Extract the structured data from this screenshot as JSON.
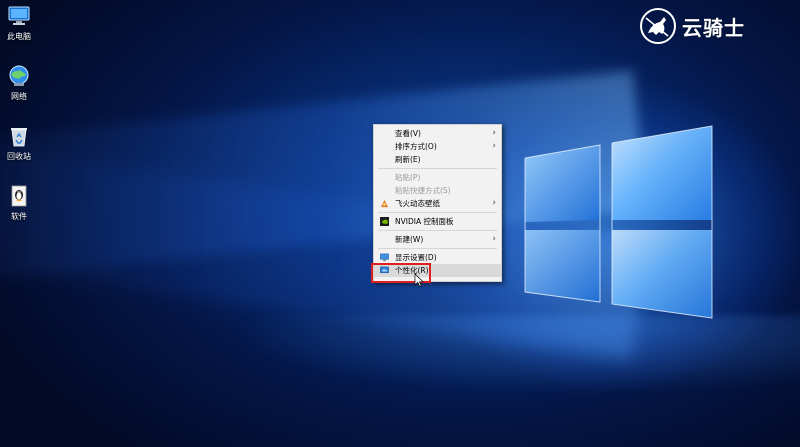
{
  "desktop": {
    "icons": [
      {
        "label": "此电脑",
        "icon": "computer-icon"
      },
      {
        "label": "网络",
        "icon": "network-globe-icon"
      },
      {
        "label": "回收站",
        "icon": "recycle-bin-icon"
      },
      {
        "label": "软件",
        "icon": "software-folder-icon"
      }
    ]
  },
  "watermark": {
    "text": "云骑士",
    "icon": "knight-rider-logo-icon"
  },
  "context_menu": {
    "items": [
      {
        "label": "查看(V)",
        "submenu": true
      },
      {
        "label": "排序方式(O)",
        "submenu": true
      },
      {
        "label": "刷新(E)"
      },
      {
        "label": "粘贴(P)",
        "disabled": true
      },
      {
        "label": "粘贴快捷方式(S)",
        "disabled": true
      },
      {
        "label": "飞火动态壁纸",
        "icon": "wallpaper-app-icon",
        "submenu": true
      },
      {
        "label": "NVIDIA 控制面板",
        "icon": "nvidia-icon"
      },
      {
        "label": "新建(W)",
        "submenu": true
      },
      {
        "label": "显示设置(D)",
        "icon": "display-icon"
      },
      {
        "label": "个性化(R)",
        "icon": "personalize-icon",
        "highlighted": true
      }
    ],
    "arrow_glyph": "›"
  },
  "colors": {
    "highlight_border": "#e02020",
    "menu_bg": "#f2f2f2",
    "wallpaper_blue": "#0b3d99"
  }
}
